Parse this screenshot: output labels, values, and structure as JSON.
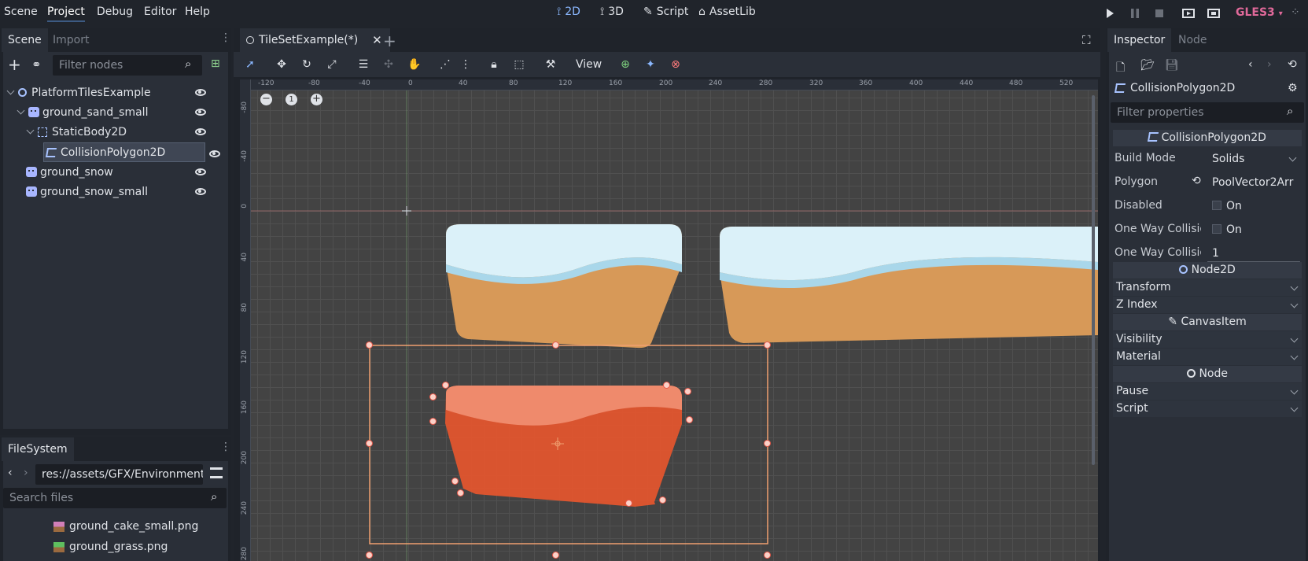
{
  "menu": [
    "Scene",
    "Project",
    "Debug",
    "Editor",
    "Help"
  ],
  "workspaces": [
    {
      "label": "2D",
      "active": true
    },
    {
      "label": "3D",
      "active": false
    },
    {
      "label": "Script",
      "active": false
    },
    {
      "label": "AssetLib",
      "active": false
    }
  ],
  "renderer": "GLES3",
  "scene_dock": {
    "tabs": [
      "Scene",
      "Import"
    ],
    "filter_placeholder": "Filter nodes",
    "nodes": [
      {
        "name": "PlatformTilesExample",
        "icon": "node2d-icon",
        "indent": 0
      },
      {
        "name": "ground_sand_small",
        "icon": "sprite-icon",
        "indent": 1
      },
      {
        "name": "StaticBody2D",
        "icon": "staticbody-icon",
        "indent": 2
      },
      {
        "name": "CollisionPolygon2D",
        "icon": "collisionpolygon-icon",
        "indent": 3,
        "selected": true
      },
      {
        "name": "ground_snow",
        "icon": "sprite-icon",
        "indent": 1
      },
      {
        "name": "ground_snow_small",
        "icon": "sprite-icon",
        "indent": 1
      }
    ]
  },
  "filesystem": {
    "title": "FileSystem",
    "path": "res://assets/GFX/Environment/g",
    "search_placeholder": "Search files",
    "files": [
      "ground_cake_small.png",
      "ground_grass.png"
    ]
  },
  "editor_tab": "TileSetExample(*)",
  "toolbar": {
    "view_label": "View"
  },
  "ruler_h": [
    "-120",
    "-80",
    "-40",
    "0",
    "40",
    "80",
    "120",
    "160",
    "200",
    "240",
    "280",
    "320",
    "360",
    "400",
    "440",
    "480",
    "520"
  ],
  "ruler_v": [
    "-80",
    "-40",
    "0",
    "40",
    "80",
    "120",
    "160",
    "200",
    "240",
    "280"
  ],
  "zoom": {
    "reset_label": "1"
  },
  "inspector": {
    "tabs": [
      "Inspector",
      "Node"
    ],
    "object_name": "CollisionPolygon2D",
    "filter_placeholder": "Filter properties",
    "class_header": "CollisionPolygon2D",
    "properties": [
      {
        "label": "Build Mode",
        "value": "Solids"
      },
      {
        "label": "Polygon",
        "value": "PoolVector2Arr"
      },
      {
        "label": "Disabled",
        "value": "On"
      },
      {
        "label": "One Way Collisio",
        "value": "On"
      },
      {
        "label": "One Way Collisio",
        "value": "1"
      }
    ],
    "sections": [
      {
        "header": "Node2D",
        "rows": [
          "Transform",
          "Z Index"
        ]
      },
      {
        "header": "CanvasItem",
        "rows": [
          "Visibility",
          "Material"
        ]
      },
      {
        "header": "Node",
        "rows": [
          "Pause",
          "Script"
        ]
      }
    ]
  }
}
